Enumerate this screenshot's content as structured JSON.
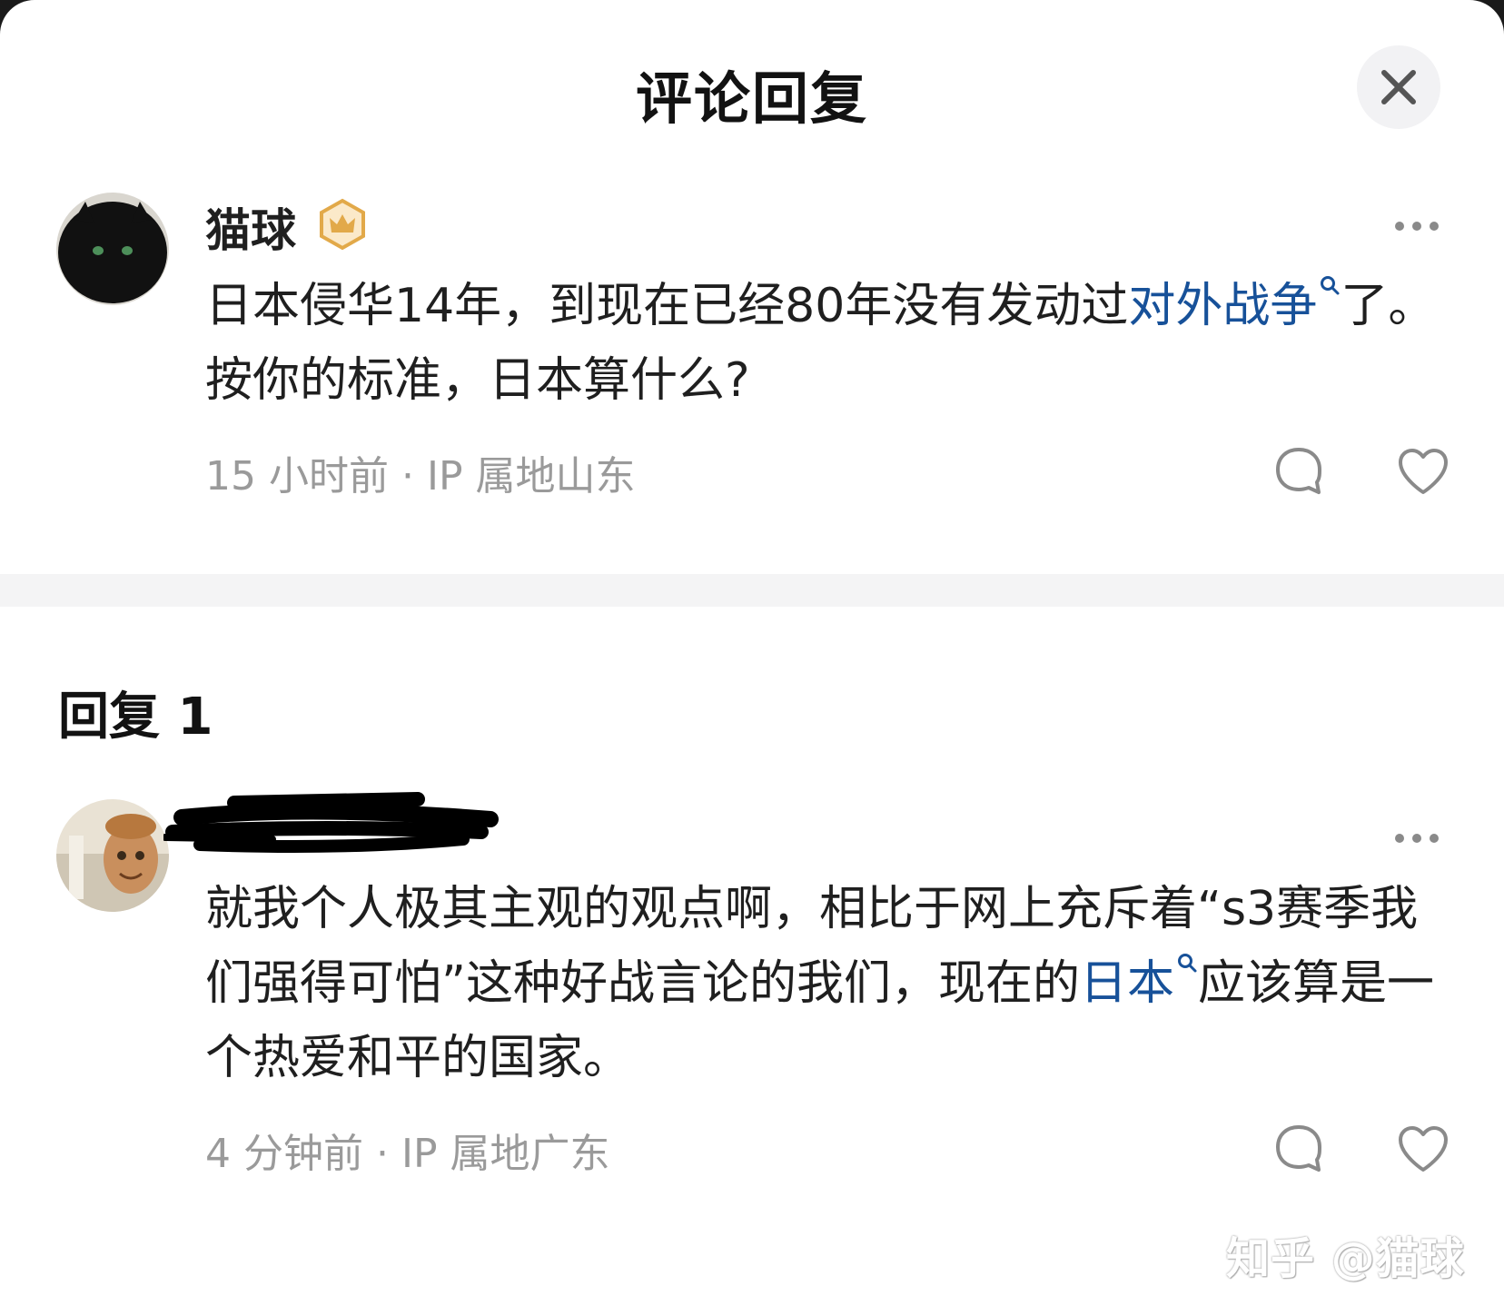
{
  "header": {
    "title": "评论回复"
  },
  "comment": {
    "username": "猫球",
    "text_before": "日本侵华14年，到现在已经80年没有发动过",
    "link_text": "对外战争",
    "text_after": "了。按你的标准，日本算什么?",
    "time": "15 小时前",
    "separator": "·",
    "ip": "IP 属地山东",
    "more_icon": "more-dots-icon",
    "reply_icon": "comment-bubble-icon",
    "like_icon": "heart-icon"
  },
  "replies": {
    "label": "回复 1"
  },
  "reply": {
    "username": "",
    "text_before": "就我个人极其主观的观点啊，相比于网上充斥着“s3赛季我们强得可怕”这种好战言论的我们，现在的",
    "link_text": "日本",
    "text_after": "应该算是一个热爱和平的国家。",
    "time": "4 分钟前",
    "separator": "·",
    "ip": "IP 属地广东"
  },
  "watermark": "知乎 @猫球",
  "colors": {
    "link": "#175199",
    "meta": "#9a9a9a",
    "badge": "#e2a949",
    "divider": "#f4f4f5"
  }
}
